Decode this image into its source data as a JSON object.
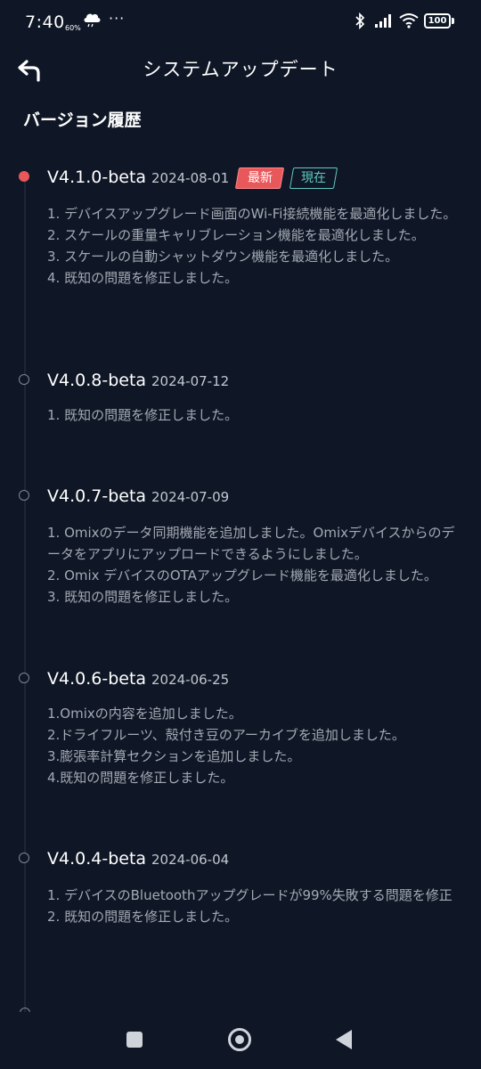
{
  "status_bar": {
    "time": "7:40",
    "weather_percent": "60%",
    "more": "···",
    "battery": "100"
  },
  "header": {
    "title": "システムアップデート",
    "back_icon": "back-arrow-icon"
  },
  "section_title": "バージョン履歴",
  "versions": [
    {
      "version": "V4.1.0-beta",
      "date": "2024-08-01",
      "badges": [
        "最新",
        "現在"
      ],
      "notes": [
        "1. デバイスアップグレード画面のWi-Fi接続機能を最適化しました。",
        "2. スケールの重量キャリブレーション機能を最適化しました。",
        "3. スケールの自動シャットダウン機能を最適化しました。",
        "4.  既知の問題を修正しました。"
      ]
    },
    {
      "version": "V4.0.8-beta",
      "date": "2024-07-12",
      "notes": [
        "1. 既知の問題を修正しました。"
      ]
    },
    {
      "version": "V4.0.7-beta",
      "date": "2024-07-09",
      "notes": [
        "1. Omixのデータ同期機能を追加しました。Omixデバイスからのデータをアプリにアップロードできるようにしました。",
        "2. Omix デバイスのOTAアップグレード機能を最適化しました。",
        "3. 既知の問題を修正しました。"
      ]
    },
    {
      "version": "V4.0.6-beta",
      "date": "2024-06-25",
      "notes": [
        "1.Omixの内容を追加しました。",
        "2.ドライフルーツ、殻付き豆のアーカイブを追加しました。",
        "3.膨張率計算セクションを追加しました。",
        "4.既知の問題を修正しました。"
      ]
    },
    {
      "version": "V4.0.4-beta",
      "date": "2024-06-04",
      "notes": [
        "1. デバイスのBluetoothアップグレードが99%失敗する問題を修正",
        "2. 既知の問題を修正しました。"
      ]
    }
  ],
  "colors": {
    "background": "#0f1726",
    "accent_red": "#e8575a",
    "accent_teal": "#5fc9c3",
    "note_text": "#a4a9b3"
  }
}
